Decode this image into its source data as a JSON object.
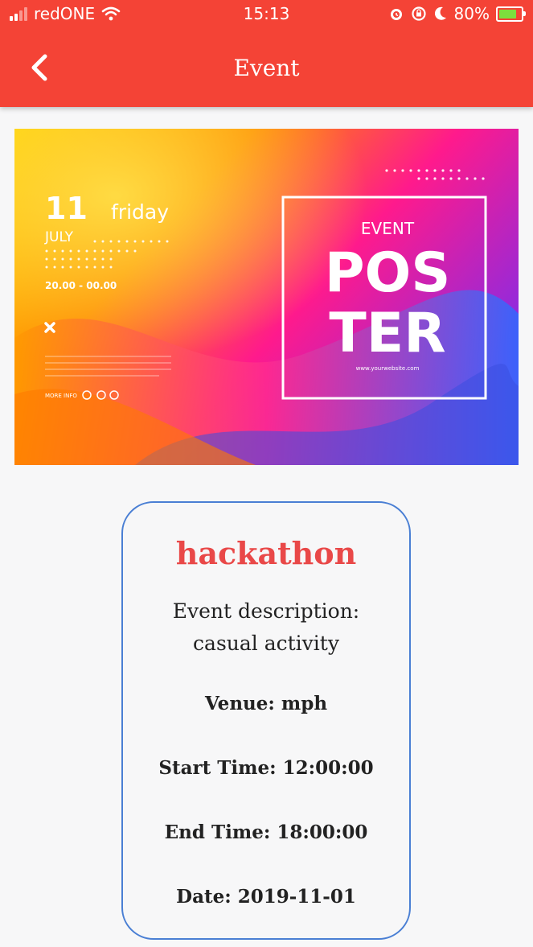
{
  "status_bar": {
    "carrier": "redONE",
    "time": "15:13",
    "battery": "80%",
    "battery_level": 0.8
  },
  "header": {
    "title": "Event",
    "back_icon": "chevron-left-icon"
  },
  "poster": {
    "day": "11",
    "weekday": "friday",
    "month": "JULY",
    "time_range": "20.00 - 00.00",
    "event_word": "EVENT",
    "big_line1": "POS",
    "big_line2": "TER",
    "website": "www.yourwebsite.com",
    "more_info": "MORE INFO",
    "colors": {
      "orange": "#ff8a00",
      "pink": "#ff1a8c",
      "blue": "#2f6bff",
      "yellow": "#ffd000"
    }
  },
  "event": {
    "name": "hackathon",
    "description_label": "Event description:",
    "description": "casual activity",
    "venue": "Venue: mph",
    "start_time": "Start Time: 12:00:00",
    "end_time": "End Time: 18:00:00",
    "date": "Date: 2019-11-01"
  },
  "colors": {
    "appbar": "#f44336",
    "card_border": "#4a7fd4",
    "event_name": "#e94848"
  }
}
